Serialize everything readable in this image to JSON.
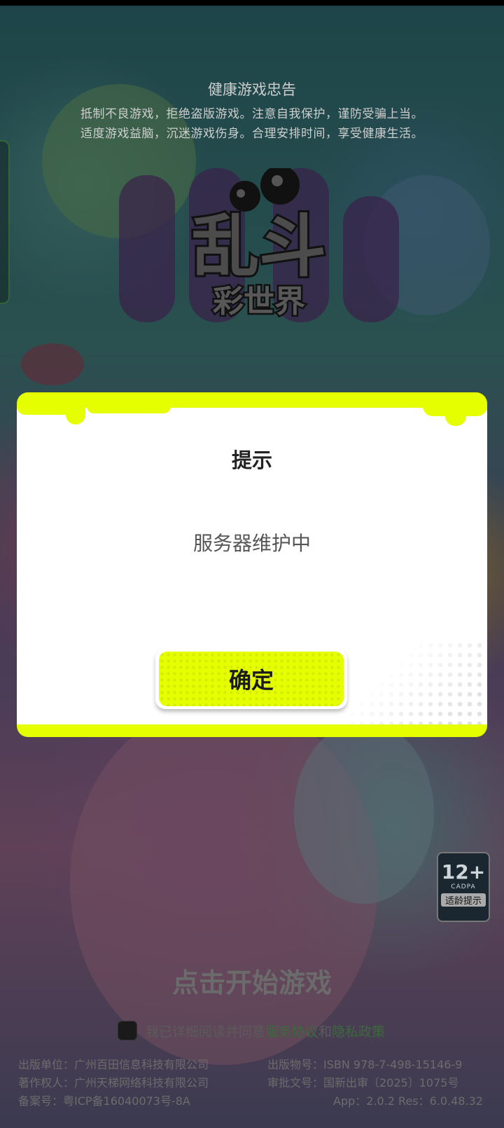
{
  "health_advice": {
    "title": "健康游戏忠告",
    "line1": "抵制不良游戏，拒绝盗版游戏。注意自我保护，谨防受骗上当。",
    "line2": "适度游戏益脑，沉迷游戏伤身。合理安排时间，享受健康生活。"
  },
  "logo": {
    "main_text": "乱斗",
    "sub_text": "彩世界"
  },
  "dialog": {
    "title": "提示",
    "message": "服务器维护中",
    "confirm_label": "确定"
  },
  "age_rating": {
    "number": "12+",
    "org": "CADPA",
    "label": "适龄提示"
  },
  "start": {
    "label": "点击开始游戏"
  },
  "agreement": {
    "prefix": "我已详细阅读并同意",
    "service_link": "服务协议",
    "and": "和",
    "privacy_link": "隐私政策"
  },
  "footer": {
    "publisher": "出版单位：广州百田信息科技有限公司",
    "copyright": "著作权人：广州天梯网络科技有限公司",
    "icp": "备案号：粤ICP备16040073号-8A",
    "isbn": "出版物号：ISBN 978-7-498-15146-9",
    "approval": "审批文号：国新出审〔2025〕1075号",
    "version": "App：2.0.2 Res：6.0.48.32"
  },
  "colors": {
    "accent": "#e6ff00",
    "dialog_bg": "#ffffff",
    "title_text": "#222222",
    "message_text": "#555555"
  }
}
